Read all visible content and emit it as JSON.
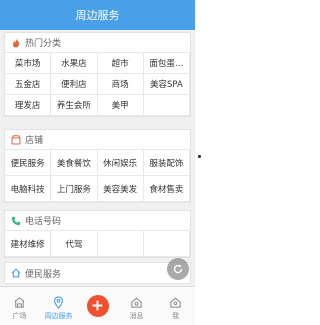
{
  "header": {
    "title": "周边服务"
  },
  "hot": {
    "title": "热门分类",
    "items": [
      "菜市场",
      "水果店",
      "超市",
      "面包蛋…",
      "五金店",
      "便利店",
      "商场",
      "美容SPA",
      "理发店",
      "养生会所",
      "美甲",
      ""
    ]
  },
  "shops": {
    "title": "店铺",
    "items": [
      "便民服务",
      "美食餐饮",
      "休闲娱乐",
      "服装配饰",
      "电脑科技",
      "上门服务",
      "美容美发",
      "食材售卖"
    ]
  },
  "phone": {
    "title": "电话号码",
    "items": [
      "建材维修",
      "代驾",
      "",
      ""
    ]
  },
  "convenience": {
    "title": "便民服务"
  },
  "tabs": [
    {
      "label": "广场",
      "icon": "plaza-icon"
    },
    {
      "label": "周边服务",
      "icon": "location-icon"
    },
    {
      "label": "",
      "icon": "add-icon"
    },
    {
      "label": "消息",
      "icon": "message-icon"
    },
    {
      "label": "我",
      "icon": "profile-icon"
    }
  ],
  "colors": {
    "accent": "#4a9fe9",
    "add_button": "#f0502e",
    "hot_icon": "#e8643c",
    "phone_icon": "#3bb58a"
  }
}
